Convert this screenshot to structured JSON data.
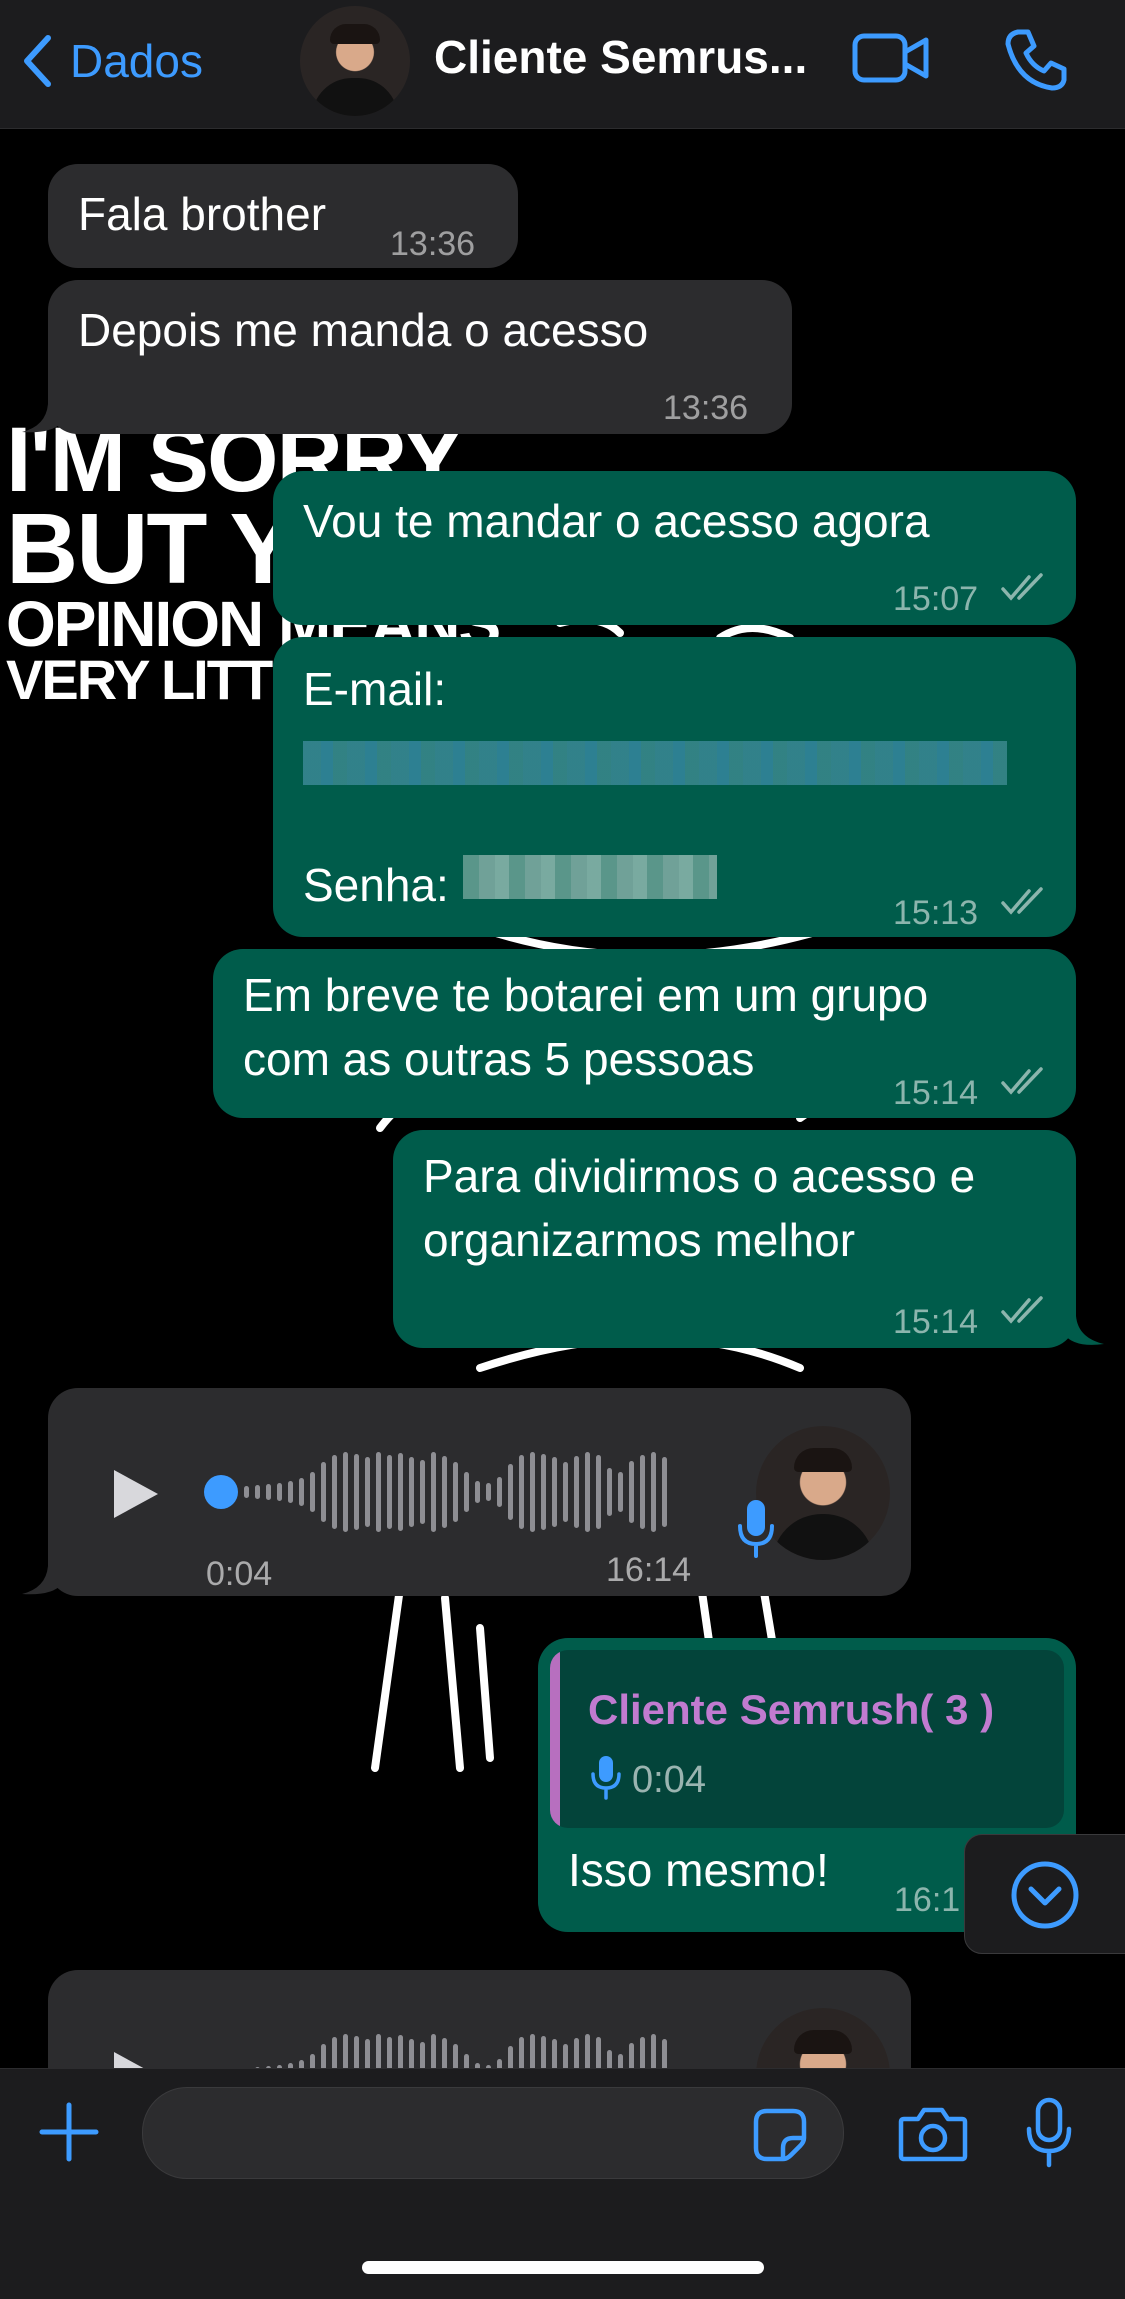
{
  "header": {
    "back_label": "Dados",
    "contact_name": "Cliente Semrus...",
    "colors": {
      "accent": "#3d9bff",
      "bar": "#1c1c1e"
    }
  },
  "wallpaper": {
    "lines": [
      "I'M SORRY",
      "BUT Y",
      "OPINION MEANS",
      "VERY LITT"
    ]
  },
  "messages": [
    {
      "dir": "in",
      "text": "Fala brother",
      "time": "13:36"
    },
    {
      "dir": "in",
      "text": "Depois me manda o acesso",
      "time": "13:36"
    },
    {
      "dir": "out",
      "text": "Vou te mandar o acesso agora",
      "time": "15:07"
    },
    {
      "dir": "out",
      "label_email": "E-mail:",
      "label_password": "Senha:",
      "time": "15:13"
    },
    {
      "dir": "out",
      "lines": [
        "Em breve te botarei em um grupo",
        "com as outras 5 pessoas"
      ],
      "time": "15:14"
    },
    {
      "dir": "out",
      "lines": [
        "Para dividirmos o acesso e",
        "organizarmos melhor"
      ],
      "time": "15:14"
    },
    {
      "dir": "in",
      "type": "voice",
      "duration": "0:04",
      "time": "16:14",
      "progress": 0
    },
    {
      "dir": "out",
      "reply_to": {
        "name": "Cliente Semrush( 3 )",
        "duration": "0:04"
      },
      "text": "Isso mesmo!",
      "time": "16:1"
    }
  ],
  "composer": {
    "icons": [
      "plus-icon",
      "sticker-icon",
      "camera-icon",
      "microphone-icon"
    ]
  }
}
